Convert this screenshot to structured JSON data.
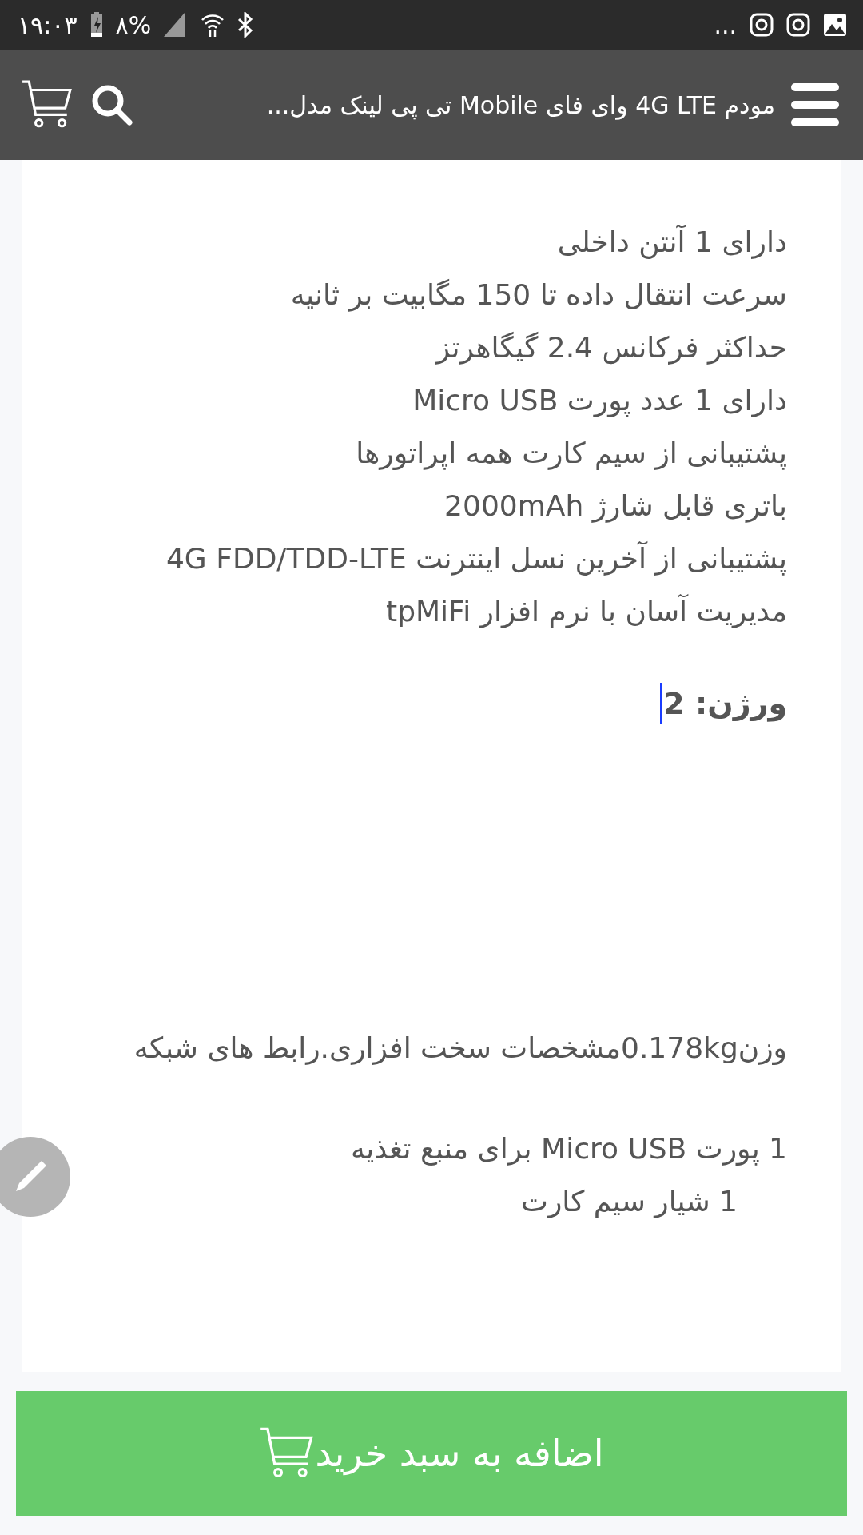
{
  "status_bar": {
    "time": "۱۹:۰۳",
    "battery": "۸%",
    "more": "..."
  },
  "header": {
    "title": "مودم 4G LTE وای فای Mobile تی پی لینک مدل..."
  },
  "features": [
    "دارای 1 آنتن داخلی",
    "سرعت انتقال داده تا 150 مگابیت بر ثانیه",
    "حداکثر فرکانس 2.4 گیگاهرتز",
    "دارای 1 عدد پورت Micro USB",
    "پشتیبانی از سیم کارت همه اپراتورها",
    "باتری قابل شارژ 2000mAh",
    "پشتیبانی از آخرین نسل اینترنت 4G FDD/TDD-LTE",
    "مدیریت آسان با نرم افزار tpMiFi"
  ],
  "version": "ورژن: 2",
  "specs": "وزن0.178kgمشخصات سخت افزاری.رابط های شبکه",
  "ports": [
    {
      "text": "1 پورت Micro USB برای منبع تغذیه",
      "kind": "plain"
    },
    {
      "text": "1 شیار سیم کارت",
      "kind": "indented"
    }
  ],
  "add_to_cart": {
    "label": "اضافه به سبد خرید"
  }
}
